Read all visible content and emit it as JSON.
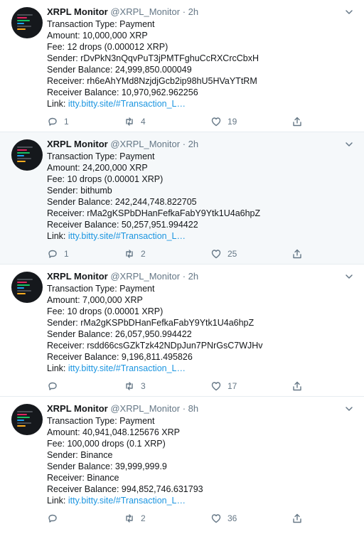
{
  "colors": {
    "accent": "#1b95e0",
    "muted": "#657786",
    "highlight_bg": "#f5f8fa",
    "divider": "#e6ecf0"
  },
  "tweets": [
    {
      "name": "XRPL Monitor",
      "handle": "@XRPL_Monitor",
      "dot": "·",
      "time": "2h",
      "lines": [
        "Transaction Type: Payment",
        "Amount: 10,000,000 XRP",
        "Fee: 12 drops (0.000012 XRP)",
        "Sender: rDvPkN3nQqvPuT3jPMTFghuCcRXCrcCbxH",
        "Sender Balance: 24,999,850.000049",
        "Receiver: rh6eAhYMd8NzjdjGcb2ip98hU5HVaYTtRM",
        "Receiver Balance: 10,970,962.962256"
      ],
      "link_label": "Link: ",
      "link_text": "itty.bitty.site/#Transaction_L…",
      "replies": "1",
      "retweets": "4",
      "likes": "19"
    },
    {
      "name": "XRPL Monitor",
      "handle": "@XRPL_Monitor",
      "dot": "·",
      "time": "2h",
      "lines": [
        "Transaction Type: Payment",
        "Amount: 24,200,000 XRP",
        "Fee: 10 drops (0.00001 XRP)",
        "Sender: bithumb",
        "Sender Balance: 242,244,748.822705",
        "Receiver: rMa2gKSPbDHanFefkaFabY9Ytk1U4a6hpZ",
        "Receiver Balance: 50,257,951.994422"
      ],
      "link_label": "Link: ",
      "link_text": "itty.bitty.site/#Transaction_L…",
      "replies": "1",
      "retweets": "2",
      "likes": "25"
    },
    {
      "name": "XRPL Monitor",
      "handle": "@XRPL_Monitor",
      "dot": "·",
      "time": "2h",
      "lines": [
        "Transaction Type: Payment",
        "Amount: 7,000,000 XRP",
        "Fee: 10 drops (0.00001 XRP)",
        "Sender: rMa2gKSPbDHanFefkaFabY9Ytk1U4a6hpZ",
        "Sender Balance: 26,057,950.994422",
        "Receiver: rsdd66csGZkTzk42NDpJun7PNrGsC7WJHv",
        "Receiver Balance: 9,196,811.495826"
      ],
      "link_label": "Link: ",
      "link_text": "itty.bitty.site/#Transaction_L…",
      "replies": "",
      "retweets": "3",
      "likes": "17"
    },
    {
      "name": "XRPL Monitor",
      "handle": "@XRPL_Monitor",
      "dot": "·",
      "time": "8h",
      "lines": [
        "Transaction Type: Payment",
        "Amount: 40,941,048.125676 XRP",
        "Fee: 100,000 drops (0.1 XRP)",
        "Sender: Binance",
        "Sender Balance: 39,999,999.9",
        "Receiver: Binance",
        "Receiver Balance: 994,852,746.631793"
      ],
      "link_label": "Link: ",
      "link_text": "itty.bitty.site/#Transaction_L…",
      "replies": "",
      "retweets": "2",
      "likes": "36"
    }
  ]
}
